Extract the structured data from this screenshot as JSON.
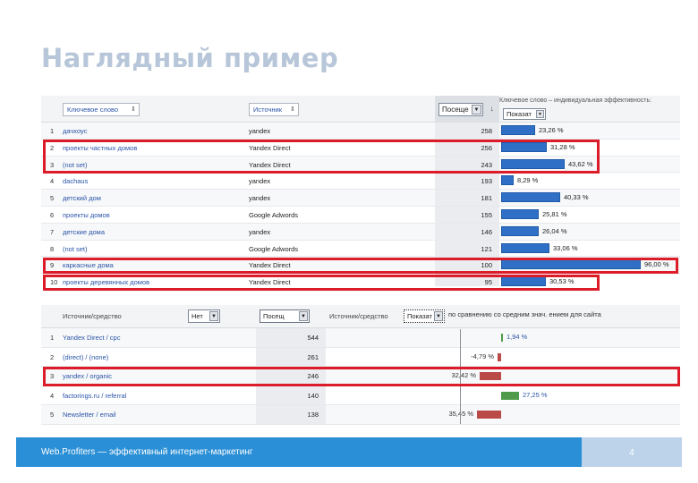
{
  "slide": {
    "title": "Наглядный пример",
    "footer": "Web.Profiters — эффективный интернет-маркетинг",
    "page_number": "4"
  },
  "table1": {
    "header": {
      "keyword_label": "Ключевое слово",
      "source_label": "Источник",
      "visits_label": "Посеще",
      "metric_label": "Ключевое слово – индивидуальная эффективность:",
      "metric_select": "Показат"
    },
    "rows": [
      {
        "num": "1",
        "keyword": "дачхоус",
        "source": "yandex",
        "visits": "258",
        "pct": 23.26,
        "pct_label": "23,26 %"
      },
      {
        "num": "2",
        "keyword": "проекты частных домов",
        "source": "Yandex Direct",
        "visits": "256",
        "pct": 31.28,
        "pct_label": "31,28 %"
      },
      {
        "num": "3",
        "keyword": "(not set)",
        "source": "Yandex Direct",
        "visits": "243",
        "pct": 43.62,
        "pct_label": "43,62 %"
      },
      {
        "num": "4",
        "keyword": "dachaus",
        "source": "yandex",
        "visits": "193",
        "pct": 8.29,
        "pct_label": "8,29 %"
      },
      {
        "num": "5",
        "keyword": "детский дом",
        "source": "yandex",
        "visits": "181",
        "pct": 40.33,
        "pct_label": "40,33 %"
      },
      {
        "num": "6",
        "keyword": "проекты домов",
        "source": "Google Adwords",
        "visits": "155",
        "pct": 25.81,
        "pct_label": "25,81 %"
      },
      {
        "num": "7",
        "keyword": "детские дома",
        "source": "yandex",
        "visits": "146",
        "pct": 26.04,
        "pct_label": "26,04 %"
      },
      {
        "num": "8",
        "keyword": "(not set)",
        "source": "Google Adwords",
        "visits": "121",
        "pct": 33.06,
        "pct_label": "33,06 %"
      },
      {
        "num": "9",
        "keyword": "каркасные дома",
        "source": "Yandex Direct",
        "visits": "100",
        "pct": 96.0,
        "pct_label": "96,00 %"
      },
      {
        "num": "10",
        "keyword": "проекты деревянных домов",
        "source": "Yandex Direct",
        "visits": "95",
        "pct": 30.53,
        "pct_label": "30,53 %"
      }
    ]
  },
  "table2": {
    "header": {
      "source_label": "Источник/средство",
      "view_select": "Нет",
      "visits_label": "Посещ",
      "source_label2": "Источник/средство",
      "compare_select": "Показат",
      "compare_label": "по сравнению со средним знач. ением для сайта"
    },
    "rows": [
      {
        "num": "1",
        "source": "Yandex Direct / cpc",
        "visits": "544",
        "delta": 1.94,
        "delta_label": "1,94 %"
      },
      {
        "num": "2",
        "source": "(direct) / (none)",
        "visits": "261",
        "delta": -4.79,
        "delta_label": "-4,79 %"
      },
      {
        "num": "3",
        "source": "yandex / organic",
        "visits": "246",
        "delta": -32.42,
        "delta_label": "32,42 %"
      },
      {
        "num": "4",
        "source": "factorings.ru / referral",
        "visits": "140",
        "delta": 27.25,
        "delta_label": "27,25 %"
      },
      {
        "num": "5",
        "source": "Newsletter / email",
        "visits": "138",
        "delta": -35.45,
        "delta_label": "35,45 %"
      }
    ]
  },
  "colors": {
    "bar": "#2f6fc6",
    "negative": "#b94a48",
    "positive": "#4f9b4b",
    "highlight": "#dd1c2a",
    "footer": "#2a8fd6"
  }
}
